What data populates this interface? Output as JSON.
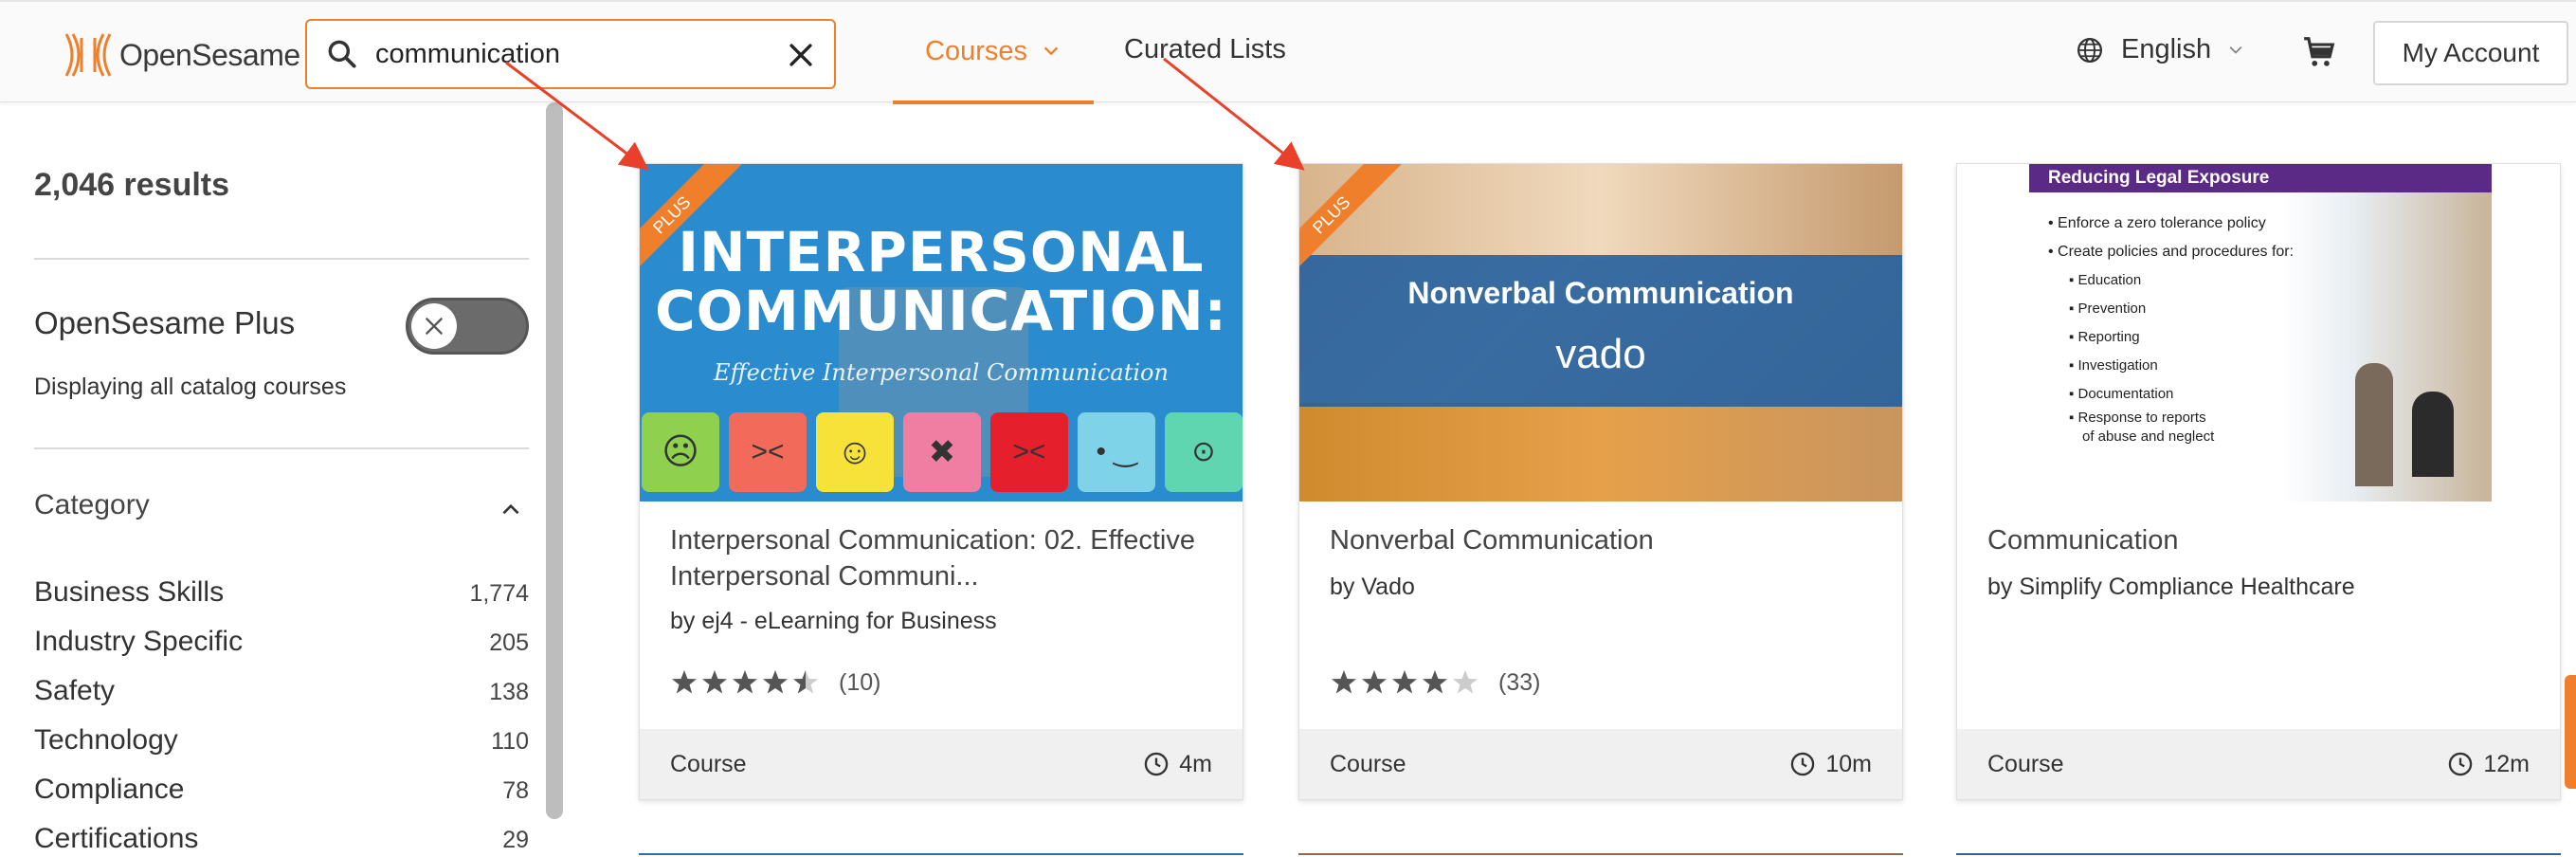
{
  "brand": {
    "name": "OpenSesame"
  },
  "search": {
    "value": "communication",
    "placeholder": ""
  },
  "nav": {
    "courses": "Courses",
    "curated": "Curated Lists"
  },
  "header": {
    "language": "English",
    "account": "My Account"
  },
  "sidebar": {
    "results": "2,046 results",
    "plus_title": "OpenSesame Plus",
    "plus_subtitle": "Displaying all catalog courses",
    "plus_enabled": false,
    "category_title": "Category",
    "categories": [
      {
        "name": "Business Skills",
        "count": "1,774"
      },
      {
        "name": "Industry Specific",
        "count": "205"
      },
      {
        "name": "Safety",
        "count": "138"
      },
      {
        "name": "Technology",
        "count": "110"
      },
      {
        "name": "Compliance",
        "count": "78"
      },
      {
        "name": "Certifications",
        "count": "29"
      }
    ]
  },
  "cards": [
    {
      "badge": "PLUS",
      "thumb_line1": "INTERPERSONAL",
      "thumb_line2": "COMMUNICATION:",
      "thumb_sub": "Effective Interpersonal Communication",
      "title": "Interpersonal Communication: 02. Effective Interpersonal Communi...",
      "provider": "by ej4 - eLearning for Business",
      "rating": 4.5,
      "reviews": "(10)",
      "type": "Course",
      "duration": "4m"
    },
    {
      "badge": "PLUS",
      "thumb_title": "Nonverbal Communication",
      "thumb_brand": "vado",
      "title": "Nonverbal Communication",
      "provider": "by Vado",
      "rating": 4,
      "reviews": "(33)",
      "type": "Course",
      "duration": "10m"
    },
    {
      "thumb_heading": "Reducing Legal Exposure",
      "thumb_bullets": [
        "Enforce a zero tolerance policy",
        "Create policies and procedures for:"
      ],
      "thumb_sub_bullets": [
        "Education",
        "Prevention",
        "Reporting",
        "Investigation",
        "Documentation",
        "Response to reports",
        "of abuse and neglect"
      ],
      "title": "Communication",
      "provider": "by Simplify Compliance Healthcare",
      "type": "Course",
      "duration": "12m"
    }
  ],
  "colors": {
    "accent": "#f07f2c",
    "annotation": "#e8402a"
  }
}
